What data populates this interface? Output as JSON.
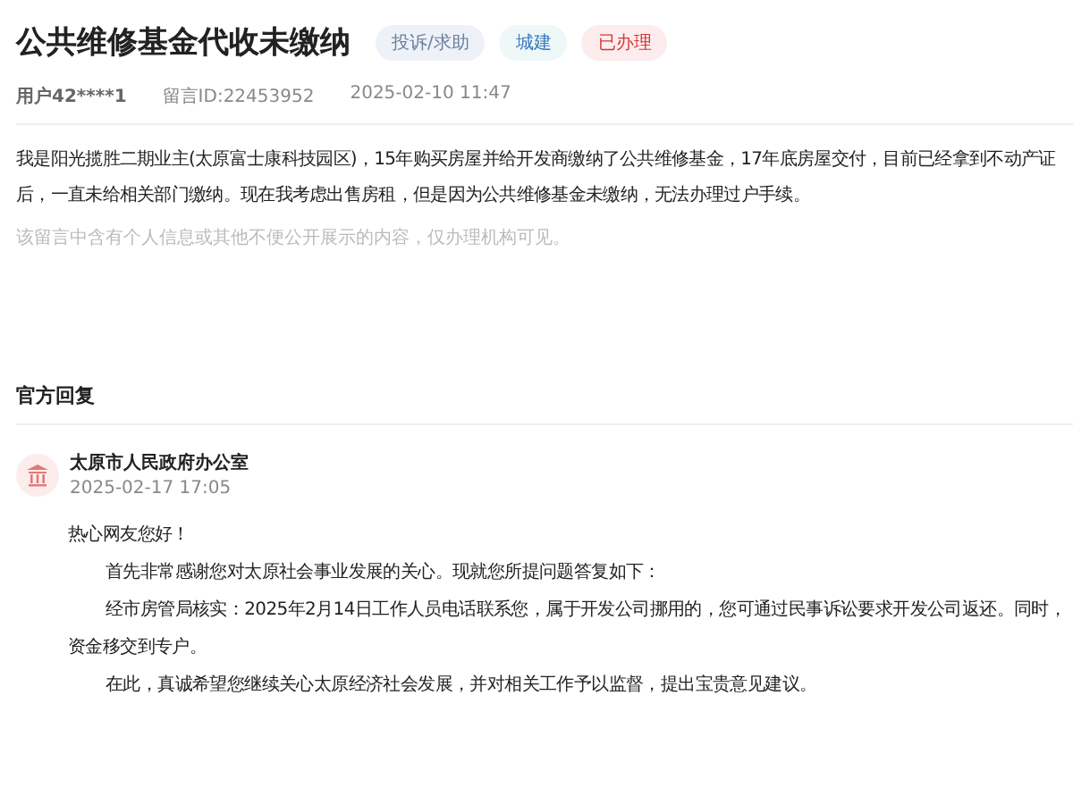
{
  "title": "公共维修基金代收未缴纳",
  "tags": [
    {
      "label": "投诉/求助",
      "kind": "type"
    },
    {
      "label": "城建",
      "kind": "category"
    },
    {
      "label": "已办理",
      "kind": "status"
    }
  ],
  "meta": {
    "user": "用户42****1",
    "message_id": "留言ID:22453952",
    "time": "2025-02-10 11:47"
  },
  "message_lines": [
    "我是阳光揽胜二期业主(太原富士康科技园区)，15年购买房屋并给开发商缴纳了公共维修基金，17年底房屋交付，目前已经拿到不动产证",
    "后，一直未给相关部门缴纳。现在我考虑出售房租，但是因为公共维修基金未缴纳，无法办理过户手续。"
  ],
  "privacy_note": "该留言中含有个人信息或其他不便公开展示的内容，仅办理机构可见。",
  "reply": {
    "heading": "官方回复",
    "office": "太原市人民政府办公室",
    "time": "2025-02-17 17:05",
    "lines": [
      {
        "kind": "plain",
        "text": "热心网友您好！"
      },
      {
        "kind": "indent",
        "text": "首先非常感谢您对太原社会事业发展的关心。现就您所提问题答复如下："
      },
      {
        "kind": "indent",
        "text": "经市房管局核实：2025年2月14日工作人员电话联系您，属于开发公司挪用的，您可通过民事诉讼要求开发公司返还。同时，"
      },
      {
        "kind": "plain",
        "text": "资金移交到专户。"
      },
      {
        "kind": "indent",
        "text": "在此，真诚希望您继续关心太原经济社会发展，并对相关工作予以监督，提出宝贵意见建议。"
      }
    ]
  }
}
